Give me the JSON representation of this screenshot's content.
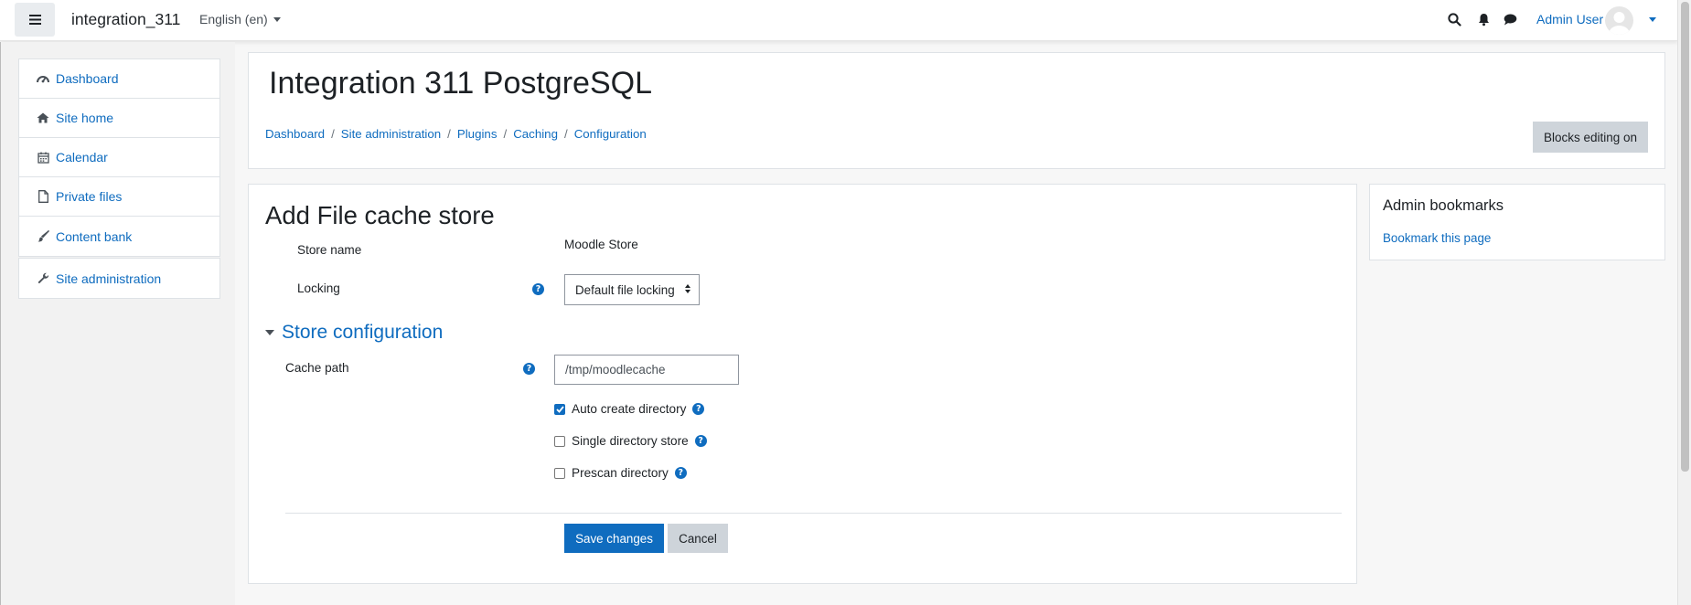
{
  "navbar": {
    "site_name": "integration_311",
    "language": "English (en)",
    "user_name": "Admin User"
  },
  "drawer": {
    "items": [
      {
        "label": "Dashboard",
        "icon": "dashboard-icon"
      },
      {
        "label": "Site home",
        "icon": "home-icon"
      },
      {
        "label": "Calendar",
        "icon": "calendar-icon"
      },
      {
        "label": "Private files",
        "icon": "file-icon"
      },
      {
        "label": "Content bank",
        "icon": "paintbrush-icon"
      }
    ],
    "admin_item": {
      "label": "Site administration",
      "icon": "wrench-icon"
    }
  },
  "header": {
    "title": "Integration 311 PostgreSQL",
    "breadcrumb": [
      "Dashboard",
      "Site administration",
      "Plugins",
      "Caching",
      "Configuration"
    ],
    "blocks_editing_button": "Blocks editing on"
  },
  "form": {
    "title": "Add File cache store",
    "store_name_label": "Store name",
    "store_name_value": "Moodle Store",
    "locking_label": "Locking",
    "locking_value": "Default file locking",
    "section_title": "Store configuration",
    "cache_path_label": "Cache path",
    "cache_path_value": "/tmp/moodlecache",
    "checkboxes": [
      {
        "label": "Auto create directory",
        "checked": true
      },
      {
        "label": "Single directory store",
        "checked": false
      },
      {
        "label": "Prescan directory",
        "checked": false
      }
    ],
    "save_button": "Save changes",
    "cancel_button": "Cancel"
  },
  "block": {
    "title": "Admin bookmarks",
    "link": "Bookmark this page"
  },
  "colors": {
    "accent": "#0f6cbf",
    "secondary_button": "#ced4da",
    "background": "#f7f7f7"
  }
}
